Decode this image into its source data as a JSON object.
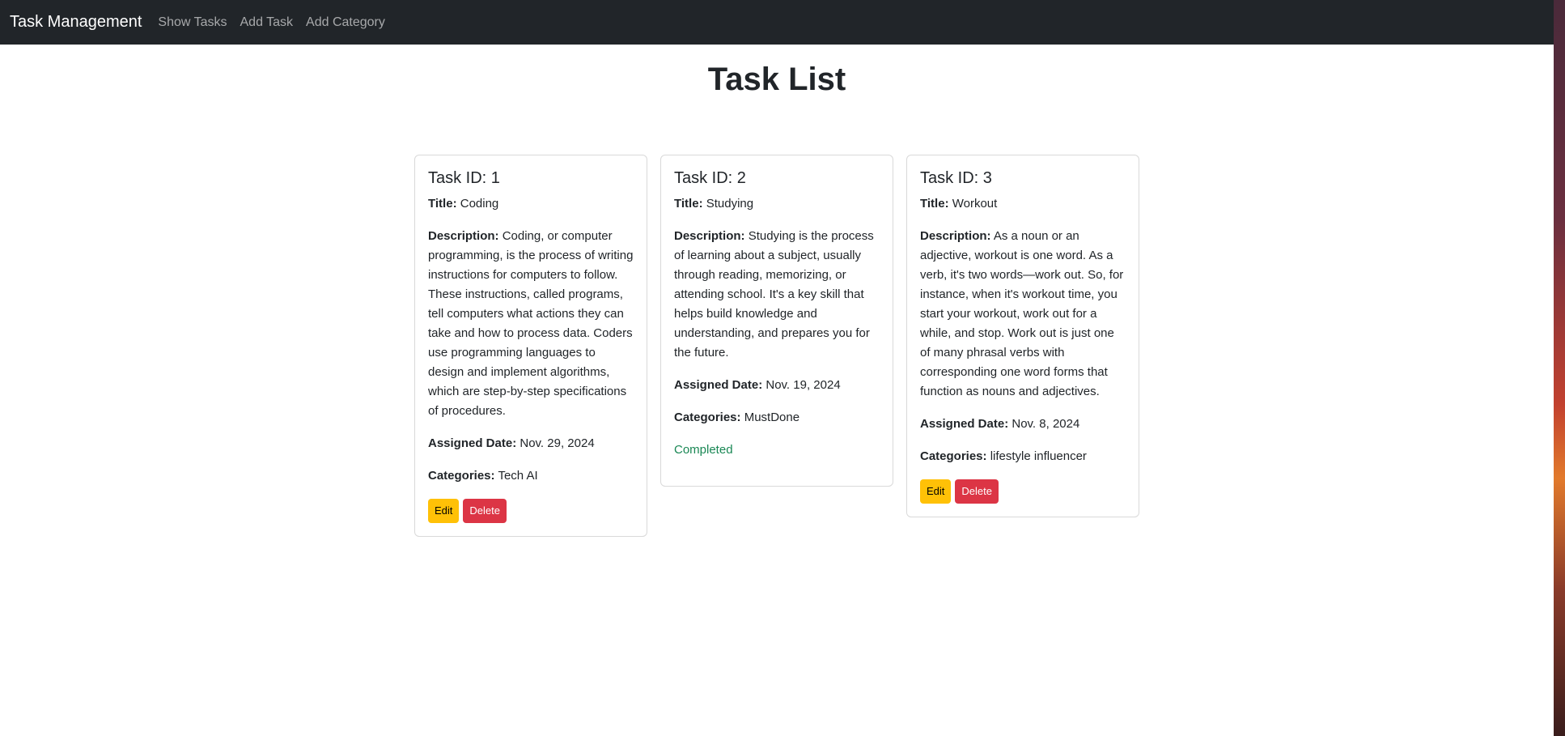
{
  "navbar": {
    "brand": "Task Management",
    "links": [
      "Show Tasks",
      "Add Task",
      "Add Category"
    ]
  },
  "page_title": "Task List",
  "labels": {
    "title": "Title:",
    "description": "Description:",
    "assigned_date": "Assigned Date:",
    "categories": "Categories:"
  },
  "buttons": {
    "edit": "Edit",
    "delete": "Delete"
  },
  "tasks": [
    {
      "heading": "Task ID: 1",
      "title": "Coding",
      "description": "Coding, or computer programming, is the process of writing instructions for computers to follow. These instructions, called programs, tell computers what actions they can take and how to process data. Coders use programming languages to design and implement algorithms, which are step-by-step specifications of procedures.",
      "assigned_date": "Nov. 29, 2024",
      "categories": "Tech AI",
      "status": ""
    },
    {
      "heading": "Task ID: 2",
      "title": "Studying",
      "description": "Studying is the process of learning about a subject, usually through reading, memorizing, or attending school. It's a key skill that helps build knowledge and understanding, and prepares you for the future.",
      "assigned_date": "Nov. 19, 2024",
      "categories": "MustDone",
      "status": "Completed"
    },
    {
      "heading": "Task ID: 3",
      "title": "Workout",
      "description": "As a noun or an adjective, workout is one word. As a verb, it's two words—work out. So, for instance, when it's workout time, you start your workout, work out for a while, and stop. Work out is just one of many phrasal verbs with corresponding one word forms that function as nouns and adjectives.",
      "assigned_date": "Nov. 8, 2024",
      "categories": "lifestyle influencer",
      "status": ""
    }
  ],
  "colors": {
    "navbar_bg": "#212529",
    "edit_button": "#ffc107",
    "delete_button": "#dc3545",
    "completed_text": "#198754"
  }
}
